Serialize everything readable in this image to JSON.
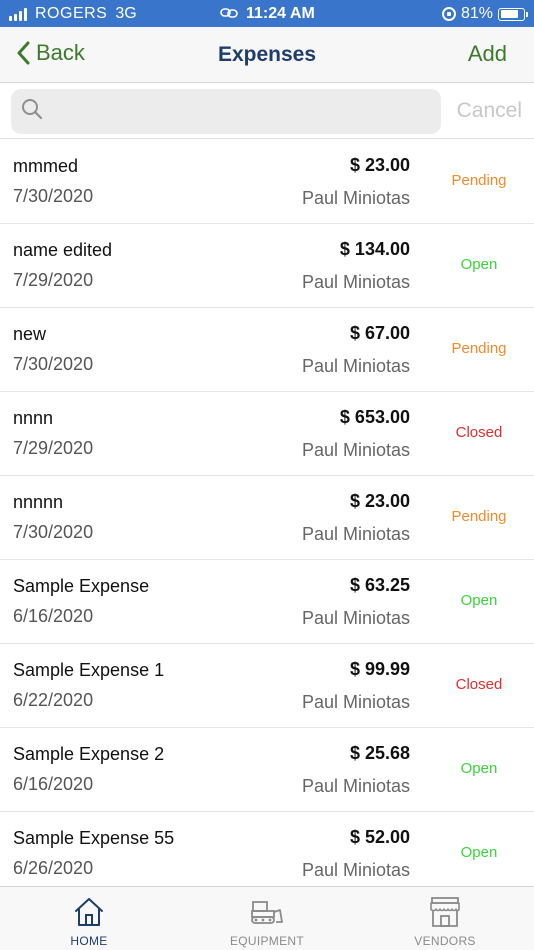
{
  "status_bar": {
    "carrier": "ROGERS",
    "network": "3G",
    "time": "11:24 AM",
    "battery": "81%"
  },
  "nav": {
    "back_label": "Back",
    "title": "Expenses",
    "add_label": "Add"
  },
  "search": {
    "value": "",
    "placeholder": "",
    "cancel_label": "Cancel"
  },
  "expenses": [
    {
      "name": "mmmed",
      "date": "7/30/2020",
      "amount": "$ 23.00",
      "person": "Paul Miniotas",
      "status": "Pending"
    },
    {
      "name": "name edited",
      "date": "7/29/2020",
      "amount": "$ 134.00",
      "person": "Paul Miniotas",
      "status": "Open"
    },
    {
      "name": "new",
      "date": "7/30/2020",
      "amount": "$ 67.00",
      "person": "Paul Miniotas",
      "status": "Pending"
    },
    {
      "name": "nnnn",
      "date": "7/29/2020",
      "amount": "$ 653.00",
      "person": "Paul Miniotas",
      "status": "Closed"
    },
    {
      "name": "nnnnn",
      "date": "7/30/2020",
      "amount": "$ 23.00",
      "person": "Paul Miniotas",
      "status": "Pending"
    },
    {
      "name": "Sample Expense",
      "date": "6/16/2020",
      "amount": "$ 63.25",
      "person": "Paul Miniotas",
      "status": "Open"
    },
    {
      "name": "Sample Expense 1",
      "date": "6/22/2020",
      "amount": "$ 99.99",
      "person": "Paul Miniotas",
      "status": "Closed"
    },
    {
      "name": "Sample Expense 2",
      "date": "6/16/2020",
      "amount": "$ 25.68",
      "person": "Paul Miniotas",
      "status": "Open"
    },
    {
      "name": "Sample Expense 55",
      "date": "6/26/2020",
      "amount": "$ 52.00",
      "person": "Paul Miniotas",
      "status": "Open"
    }
  ],
  "status_colors": {
    "Pending": "#f08a2a",
    "Open": "#38d63a",
    "Closed": "#e02e2e"
  },
  "tabs": [
    {
      "label": "HOME",
      "icon": "home-icon",
      "active": true
    },
    {
      "label": "EQUIPMENT",
      "icon": "bulldozer-icon",
      "active": false
    },
    {
      "label": "VENDORS",
      "icon": "storefront-icon",
      "active": false
    }
  ],
  "colors": {
    "status_bar_bg": "#3a75cc",
    "nav_title": "#1f3d6b",
    "nav_action": "#3c7a2c"
  }
}
